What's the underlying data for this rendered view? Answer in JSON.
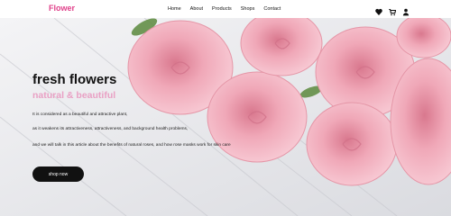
{
  "header": {
    "brand": "Flower",
    "nav": [
      "Home",
      "About",
      "Products",
      "Shops",
      "Contact"
    ],
    "icons": [
      "heart-icon",
      "cart-icon",
      "user-icon"
    ]
  },
  "hero": {
    "title": "fresh flowers",
    "subtitle": "natural & beautiful",
    "paragraphs": [
      "It is considered as a beautiful and attractive plant,",
      "as it weakens its attractiveness, attractiveness, and background health problems,",
      "and we will talk in this article about the benefits of natural roses, and how rose masks work for skin care"
    ],
    "button_label": "shop now"
  },
  "colors": {
    "brand": "#e0408a",
    "accent": "#e9a0c4",
    "button": "#111111"
  }
}
